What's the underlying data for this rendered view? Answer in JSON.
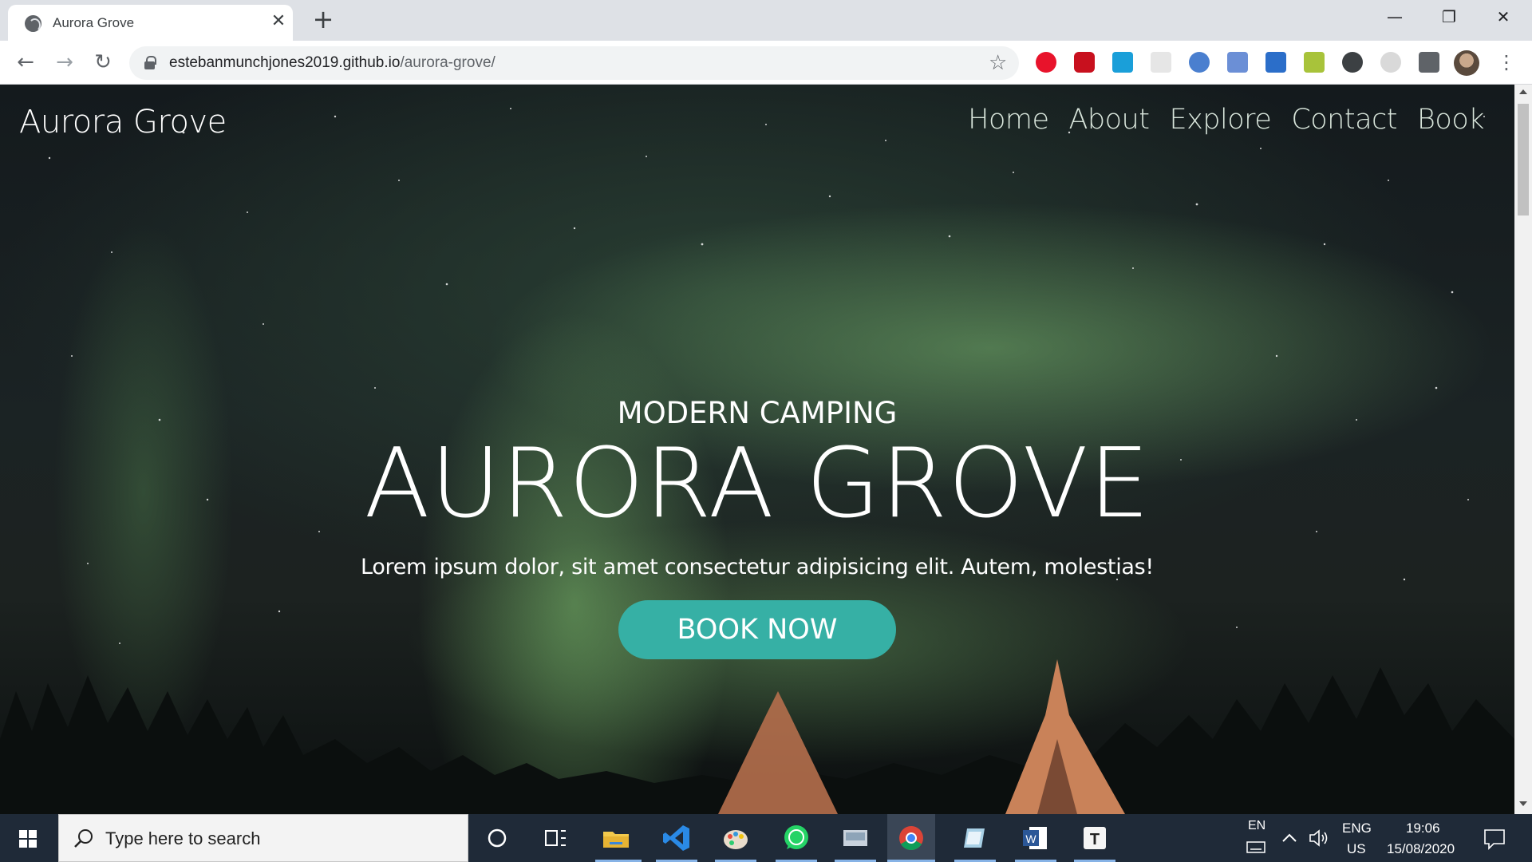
{
  "browser": {
    "tab_title": "Aurora Grove",
    "url_host": "estebanmunchjones2019.github.io",
    "url_path": "/aurora-grove/"
  },
  "site": {
    "brand": "Aurora Grove",
    "nav": [
      "Home",
      "About",
      "Explore",
      "Contact",
      "Book"
    ]
  },
  "hero": {
    "subtitle": "MODERN CAMPING",
    "title": "AURORA GROVE",
    "text": "Lorem ipsum dolor, sit amet consectetur adipisicing elit. Autem, molestias!",
    "cta": "BOOK NOW",
    "cta_color": "#36b0a5"
  },
  "taskbar": {
    "search_placeholder": "Type here to search",
    "lang_short": "EN",
    "lang": "ENG",
    "region": "US",
    "time": "19:06",
    "date": "15/08/2020",
    "apps": [
      "file-explorer-icon",
      "vscode-icon",
      "paint-icon",
      "whatsapp-icon",
      "scanner-icon",
      "chrome-icon",
      "notepad-icon",
      "word-icon",
      "typora-icon"
    ]
  }
}
